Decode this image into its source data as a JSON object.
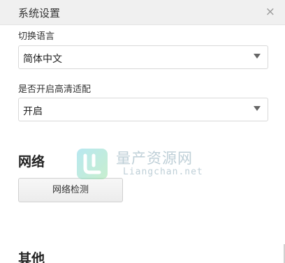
{
  "window": {
    "title": "系统设置",
    "close_glyph": "×"
  },
  "language": {
    "label": "切换语言",
    "selected": "简体中文",
    "icon": "chevron-down-icon"
  },
  "hd": {
    "label": "是否开启高清适配",
    "selected": "开启",
    "icon": "chevron-down-icon"
  },
  "network": {
    "heading": "网络",
    "check_button": "网络检测"
  },
  "other": {
    "heading": "其他"
  },
  "watermark": {
    "text": "量产资源网",
    "url": "Liangchan.net",
    "colors": {
      "logo_cyan": "#7fd6e6",
      "logo_green": "#9be2a7",
      "text": "#8aa8b7"
    }
  }
}
